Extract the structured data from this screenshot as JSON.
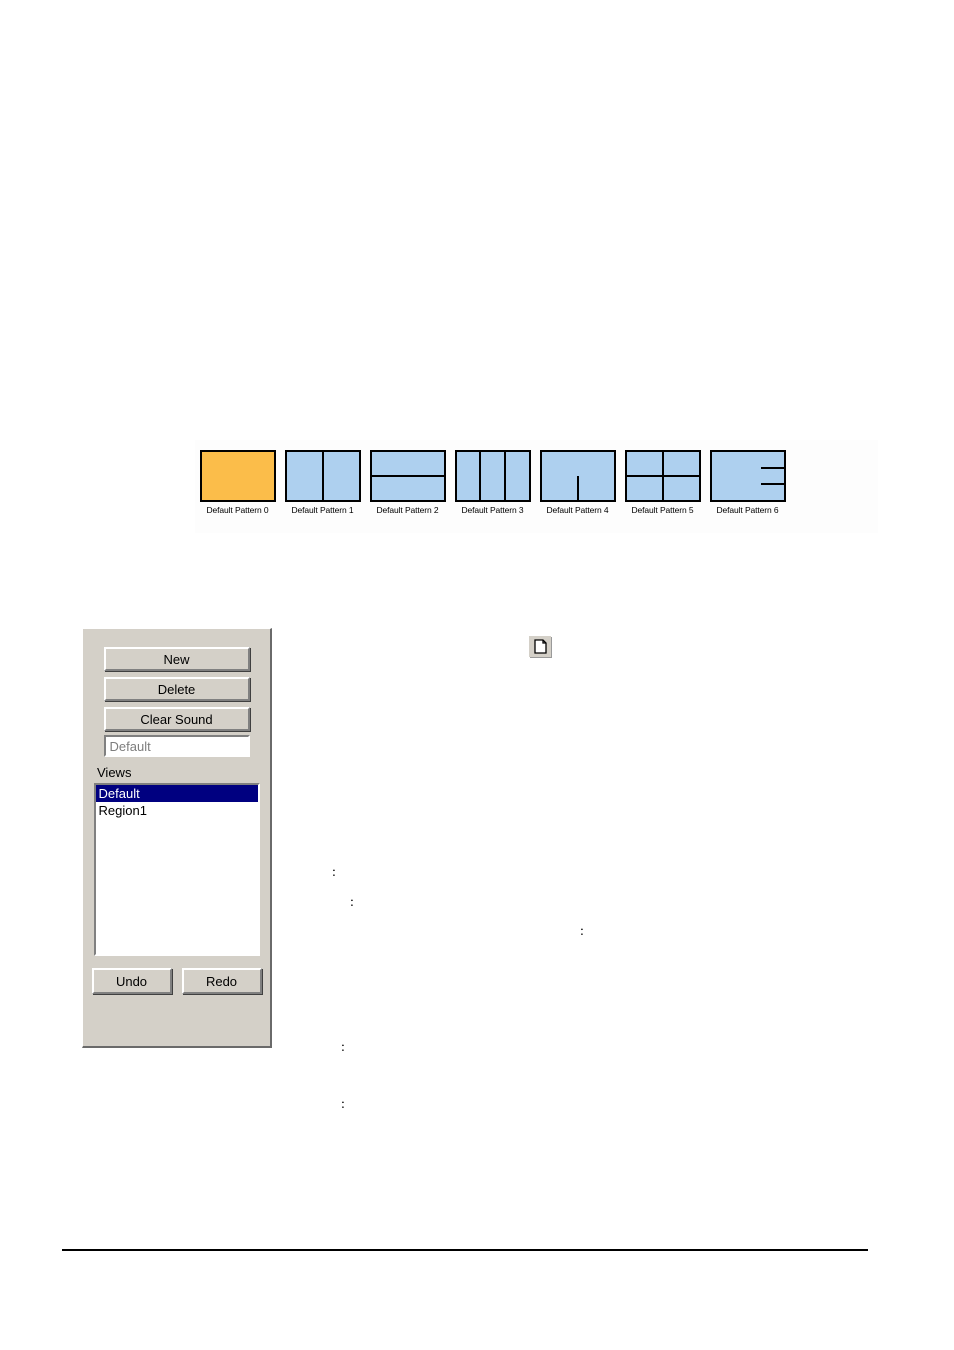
{
  "pattern_gallery": {
    "name": "layout-pattern-gallery",
    "selected_index": 0,
    "patterns": [
      {
        "label": "Default Pattern 0",
        "layout": "single",
        "selected": true
      },
      {
        "label": "Default Pattern 1",
        "layout": "two-columns",
        "selected": false
      },
      {
        "label": "Default Pattern 2",
        "layout": "two-rows",
        "selected": false
      },
      {
        "label": "Default Pattern 3",
        "layout": "three-columns",
        "selected": false
      },
      {
        "label": "Default Pattern 4",
        "layout": "top-row-two-below",
        "selected": false
      },
      {
        "label": "Default Pattern 5",
        "layout": "two-by-two-grid",
        "selected": false
      },
      {
        "label": "Default Pattern 6",
        "layout": "main-plus-three-right",
        "selected": false
      }
    ],
    "colors": {
      "pane_fill": "#aed0ef",
      "selected_fill": "#fbbd4a",
      "border": "#000000",
      "strip_background": "#fdfdfd"
    }
  },
  "views_dialog": {
    "buttons": {
      "new": "New",
      "delete": "Delete",
      "clear_sound": "Clear Sound",
      "undo": "Undo",
      "redo": "Redo"
    },
    "name_field": {
      "value": "Default",
      "placeholder": "Default"
    },
    "group_label": "Views",
    "list": {
      "items": [
        {
          "label": "Default",
          "selected": true
        },
        {
          "label": "Region1",
          "selected": false
        }
      ]
    },
    "colors": {
      "dialog_face": "#d4d0c8",
      "selection": "#000080",
      "selection_text": "#ffffff",
      "field_background": "#ffffff"
    }
  },
  "toolbar": {
    "page_icon": "new-document-icon"
  },
  "stray_marks": {
    "colons": [
      ":",
      ":",
      ":",
      ":",
      ":"
    ]
  }
}
